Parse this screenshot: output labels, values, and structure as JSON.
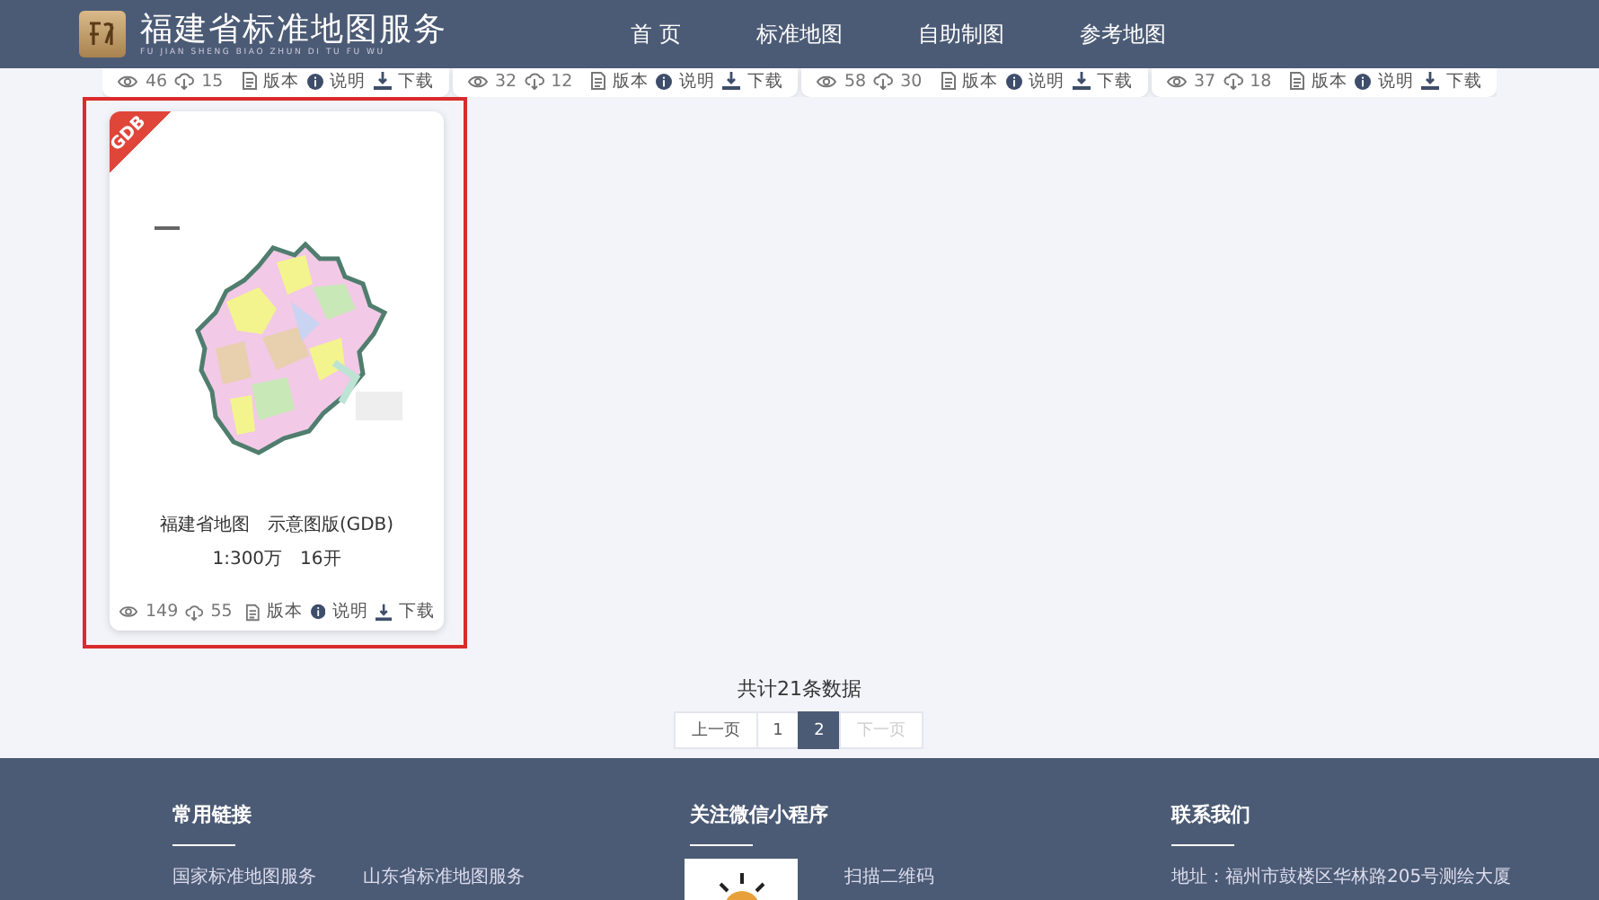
{
  "header": {
    "logo_title": "福建省标准地图服务",
    "logo_subtitle": "FU JIAN SHENG BIAO ZHUN DI TU FU WU",
    "nav": [
      "首 页",
      "标准地图",
      "自助制图",
      "参考地图"
    ]
  },
  "top_cards": [
    {
      "views": "46",
      "downloads": "15",
      "actions": [
        "版本",
        "说明",
        "下载"
      ]
    },
    {
      "views": "32",
      "downloads": "12",
      "actions": [
        "版本",
        "说明",
        "下载"
      ]
    },
    {
      "views": "58",
      "downloads": "30",
      "actions": [
        "版本",
        "说明",
        "下载"
      ]
    },
    {
      "views": "37",
      "downloads": "18",
      "actions": [
        "版本",
        "说明",
        "下载"
      ]
    }
  ],
  "featured_card": {
    "highlighted": true,
    "badge": "GDB",
    "title": "福建省地图　示意图版(GDB)",
    "subtitle": "1:300万　16开",
    "views": "149",
    "downloads": "55",
    "actions": [
      "版本",
      "说明",
      "下载"
    ]
  },
  "pagination": {
    "total": "共计21条数据",
    "prev": {
      "label": "上一页",
      "disabled": false
    },
    "pages": [
      {
        "label": "1",
        "selected": false
      },
      {
        "label": "2",
        "selected": true
      }
    ],
    "next": {
      "label": "下一页",
      "disabled": true
    }
  },
  "footer": {
    "sections": [
      {
        "kind": "links",
        "title": "常用链接",
        "items": [
          "国家标准地图服务",
          "山东省标准地图服务"
        ]
      },
      {
        "kind": "qr",
        "title": "关注微信小程序",
        "items": [
          "扫描二维码"
        ]
      },
      {
        "kind": "text",
        "title": "联系我们",
        "items": [
          "地址：福州市鼓楼区华林路205号测绘大厦"
        ]
      }
    ]
  }
}
